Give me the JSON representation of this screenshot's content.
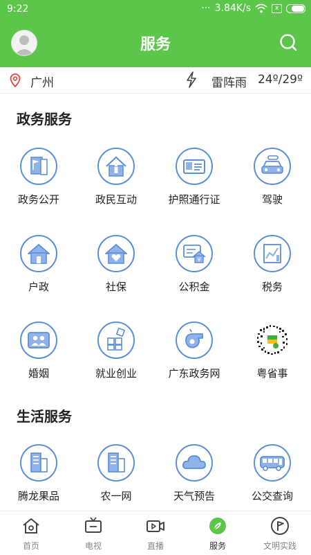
{
  "status_bar": {
    "time": "9:22",
    "dots": "···",
    "speed": "3.84K/s",
    "sim": "x"
  },
  "header": {
    "title": "服务"
  },
  "weather": {
    "city": "广州",
    "condition": "雷阵雨",
    "temperature": "24º/29º"
  },
  "sections": [
    {
      "title": "政务服务",
      "items": [
        {
          "label": "政务公开",
          "icon": "flag-doc-icon"
        },
        {
          "label": "政民互动",
          "icon": "house-person-icon"
        },
        {
          "label": "护照通行证",
          "icon": "id-card-icon"
        },
        {
          "label": "驾驶",
          "icon": "car-icon"
        },
        {
          "label": "户政",
          "icon": "house-icon"
        },
        {
          "label": "社保",
          "icon": "house-heart-icon"
        },
        {
          "label": "公积金",
          "icon": "house-fund-icon"
        },
        {
          "label": "税务",
          "icon": "chart-icon"
        },
        {
          "label": "婚姻",
          "icon": "couple-icon"
        },
        {
          "label": "就业创业",
          "icon": "blocks-icon"
        },
        {
          "label": "广东政务网",
          "icon": "whistle-icon"
        },
        {
          "label": "粤省事",
          "icon": "qr-code-icon"
        }
      ]
    },
    {
      "title": "生活服务",
      "items": [
        {
          "label": "腾龙果品",
          "icon": "building-icon"
        },
        {
          "label": "农一网",
          "icon": "building-icon"
        },
        {
          "label": "天气预告",
          "icon": "cloud-icon"
        },
        {
          "label": "公交查询",
          "icon": "bus-icon"
        }
      ]
    }
  ],
  "tabs": [
    {
      "label": "首页",
      "icon": "home-icon",
      "active": false
    },
    {
      "label": "电视",
      "icon": "tv-icon",
      "active": false
    },
    {
      "label": "直播",
      "icon": "live-video-icon",
      "active": false
    },
    {
      "label": "服务",
      "icon": "compass-leaf-icon",
      "active": true
    },
    {
      "label": "文明实践",
      "icon": "flag-circle-icon",
      "active": false
    }
  ],
  "colors": {
    "header_green": "#5cc64a",
    "icon_blue": "#5b8fd6",
    "active_green": "#5cc64a"
  }
}
